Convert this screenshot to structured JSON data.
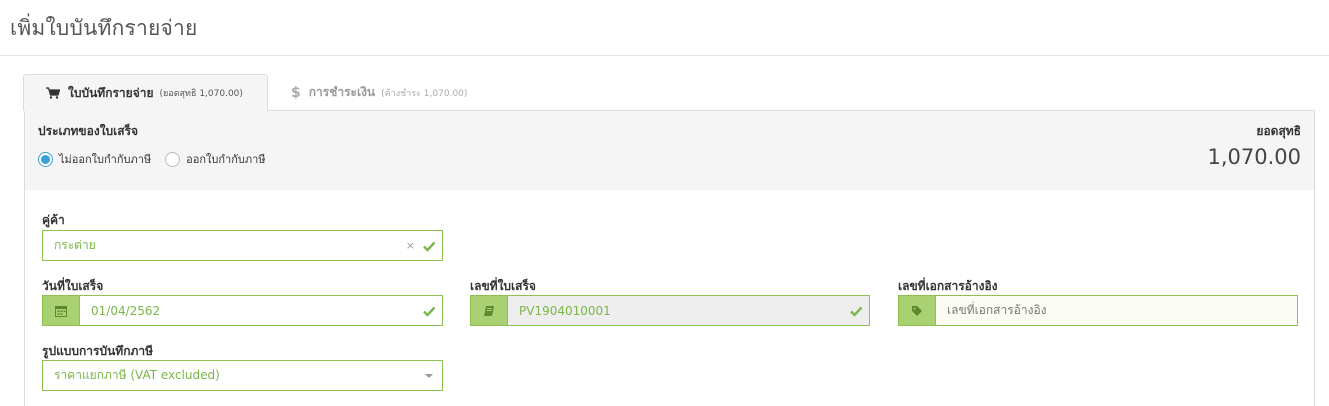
{
  "page": {
    "title": "เพิ่มใบบันทึกรายจ่าย"
  },
  "tabs": [
    {
      "label": "ใบบันทึกรายจ่าย",
      "note": "(ยอดสุทธิ 1,070.00)",
      "icon": "shopping-cart-icon"
    },
    {
      "label": "การชำระเงิน",
      "note": "(ค้างชำระ 1,070.00)",
      "icon": "dollar-icon",
      "icon_glyph": "$"
    }
  ],
  "header": {
    "doc_type_label": "ประเภทของใบเสร็จ",
    "options": [
      {
        "label": "ไม่ออกใบกำกับภาษี",
        "selected": true
      },
      {
        "label": "ออกใบกำกับภาษี",
        "selected": false
      }
    ],
    "net_label": "ยอดสุทธิ",
    "net_value": "1,070.00"
  },
  "form": {
    "vendor": {
      "label": "คู่ค้า",
      "value": "กระต่าย",
      "clear": "×"
    },
    "receipt_date": {
      "label": "วันที่ใบเสร็จ",
      "value": "01/04/2562",
      "icon": "calendar-icon"
    },
    "receipt_no": {
      "label": "เลขที่ใบเสร็จ",
      "value": "PV1904010001",
      "icon": "book-icon"
    },
    "reference": {
      "label": "เลขที่เอกสารอ้างอิง",
      "placeholder": "เลขที่เอกสารอ้างอิง",
      "icon": "tag-icon"
    },
    "tax_mode": {
      "label": "รูปแบบการบันทึกภาษี",
      "value": "ราคาแยกภาษี (VAT excluded)"
    }
  },
  "colors": {
    "valid_border": "#8cc152",
    "addon_bg": "#a9d071",
    "radio_accent": "#3a9ed8",
    "valid_text": "#7ab648"
  }
}
